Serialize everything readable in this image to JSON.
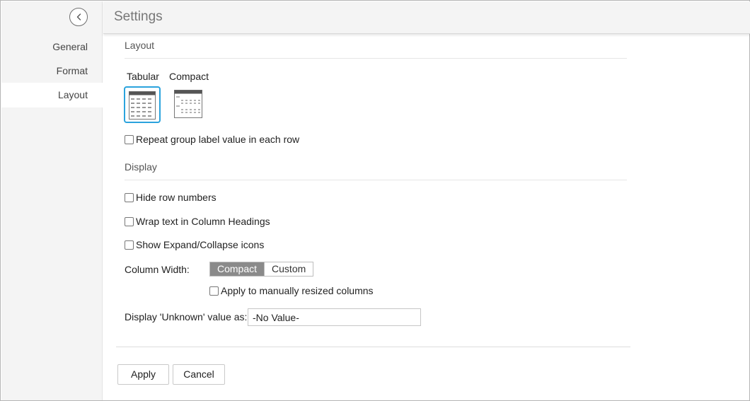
{
  "header": {
    "title": "Settings"
  },
  "sidebar": {
    "back_icon": "chevron-left-icon",
    "items": [
      {
        "label": "General",
        "active": false
      },
      {
        "label": "Format",
        "active": false
      },
      {
        "label": "Layout",
        "active": true
      }
    ]
  },
  "layout_section": {
    "heading": "Layout",
    "options": [
      {
        "label": "Tabular",
        "selected": true
      },
      {
        "label": "Compact",
        "selected": false
      }
    ],
    "repeat_group_label": {
      "label": "Repeat group label value in each row",
      "checked": false
    }
  },
  "display_section": {
    "heading": "Display",
    "hide_row_numbers": {
      "label": "Hide row numbers",
      "checked": false
    },
    "wrap_text": {
      "label": "Wrap text in Column Headings",
      "checked": false
    },
    "show_expand_collapse": {
      "label": "Show Expand/Collapse icons",
      "checked": false
    },
    "column_width": {
      "label": "Column Width:",
      "options": [
        "Compact",
        "Custom"
      ],
      "selected": "Compact",
      "apply_resized": {
        "label": "Apply to manually resized columns",
        "checked": false
      }
    },
    "unknown_value": {
      "label": "Display 'Unknown' value as:",
      "value": "-No Value-"
    }
  },
  "footer": {
    "apply_label": "Apply",
    "cancel_label": "Cancel"
  },
  "colors": {
    "accent": "#2ba3dd",
    "segment_selected": "#8a8a8a",
    "sidebar_bg": "#f4f4f4"
  }
}
